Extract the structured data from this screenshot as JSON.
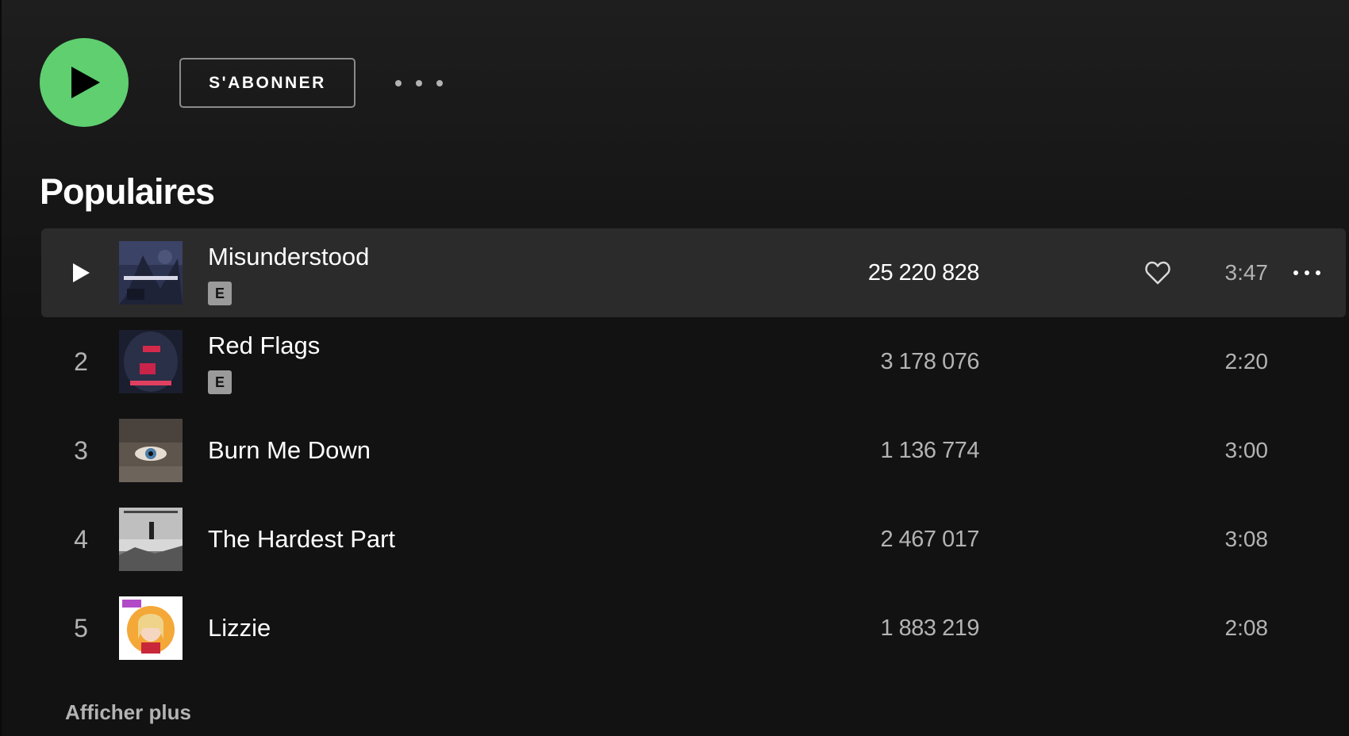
{
  "action_bar": {
    "subscribe_label": "S'ABONNER"
  },
  "section": {
    "title": "Populaires"
  },
  "tracks": [
    {
      "index": "1",
      "title": "Misunderstood",
      "explicit": "E",
      "plays": "25 220 828",
      "duration": "3:47",
      "state": "hover"
    },
    {
      "index": "2",
      "title": "Red Flags",
      "explicit": "E",
      "plays": "3 178 076",
      "duration": "2:20"
    },
    {
      "index": "3",
      "title": "Burn Me Down",
      "plays": "1 136 774",
      "duration": "3:00"
    },
    {
      "index": "4",
      "title": "The Hardest Part",
      "plays": "2 467 017",
      "duration": "3:08"
    },
    {
      "index": "5",
      "title": "Lizzie",
      "plays": "1 883 219",
      "duration": "2:08"
    }
  ],
  "footer": {
    "show_more_label": "Afficher plus"
  },
  "colors": {
    "accent_green": "#5fcf70",
    "background": "#121212",
    "row_hover": "#2b2b2b",
    "text_secondary": "#b3b3b3"
  },
  "icons": {
    "play_main": "play-icon",
    "more_options": "more-horizontal-icon",
    "like": "heart-outline-icon",
    "explicit": "explicit-badge"
  }
}
